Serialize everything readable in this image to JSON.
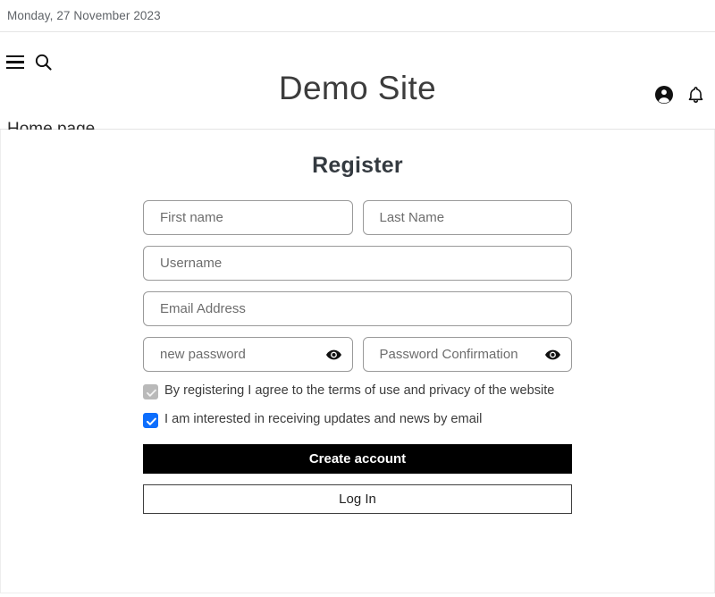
{
  "topbar": {
    "date": "Monday, 27 November 2023"
  },
  "header": {
    "title": "Demo Site",
    "menu_icon": "hamburger-menu-icon",
    "search_icon": "search-icon",
    "account_icon": "account-circle-icon",
    "notification_icon": "bell-icon",
    "home_link": "Home page"
  },
  "form": {
    "title": "Register",
    "fields": {
      "first_name": {
        "placeholder": "First name",
        "value": ""
      },
      "last_name": {
        "placeholder": "Last Name",
        "value": ""
      },
      "username": {
        "placeholder": "Username",
        "value": ""
      },
      "email": {
        "placeholder": "Email Address",
        "value": ""
      },
      "password": {
        "placeholder": "new password",
        "value": ""
      },
      "password_confirm": {
        "placeholder": "Password Confirmation",
        "value": ""
      }
    },
    "eye_icon": "eye-show-password-icon",
    "checkboxes": [
      {
        "label": "By registering I agree to the terms of use and privacy of the website",
        "checked": true,
        "state": "disabled",
        "color": "#b9b9b9"
      },
      {
        "label": "I am interested in receiving updates and news by email",
        "checked": true,
        "state": "enabled",
        "color": "#0d6efd"
      }
    ],
    "buttons": {
      "create_account": "Create account",
      "log_in": "Log In"
    }
  },
  "colors": {
    "primary_button_bg": "#000000",
    "checkbox_accent": "#0d6efd",
    "checkbox_disabled": "#b9b9b9",
    "border": "#9a9a9a",
    "text": "#212529",
    "muted_text": "#5f6368"
  }
}
